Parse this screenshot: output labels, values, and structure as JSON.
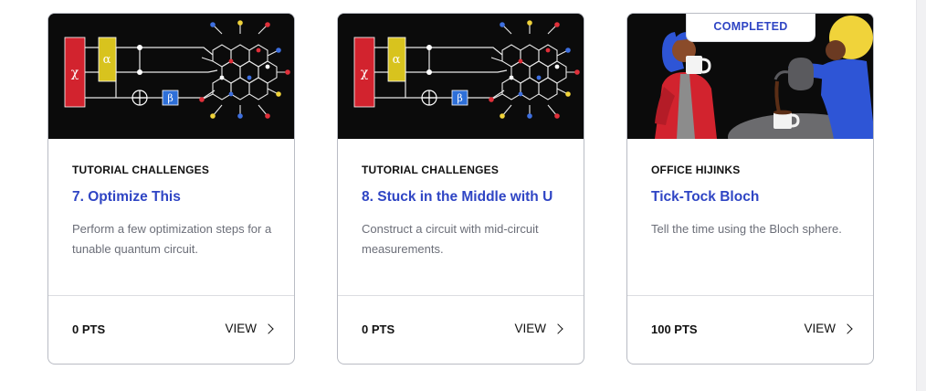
{
  "cards": [
    {
      "category": "TUTORIAL CHALLENGES",
      "title": "7. Optimize This",
      "description": "Perform a few optimization steps for a tunable quantum circuit.",
      "points": "0 PTS",
      "view_label": "VIEW",
      "image": "quantum-circuit-illustration"
    },
    {
      "category": "TUTORIAL CHALLENGES",
      "title": "8. Stuck in the Middle with U",
      "description": "Construct a circuit with mid-circuit measurements.",
      "points": "0 PTS",
      "view_label": "VIEW",
      "image": "quantum-circuit-illustration"
    },
    {
      "category": "OFFICE HIJINKS",
      "title": "Tick-Tock Bloch",
      "description": "Tell the time using the Bloch sphere.",
      "points": "100 PTS",
      "view_label": "VIEW",
      "badge": "COMPLETED",
      "image": "coffee-office-illustration"
    }
  ],
  "colors": {
    "accent": "#2f45c4",
    "border": "#b9bcc4",
    "muted_text": "#6b6e78"
  }
}
